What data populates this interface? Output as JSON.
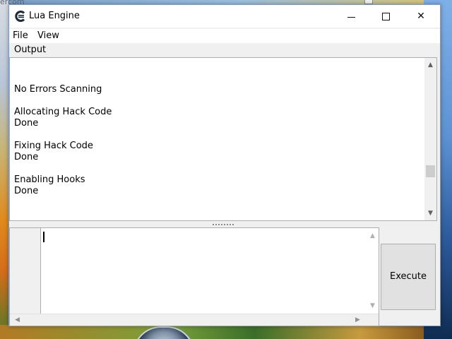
{
  "background": {
    "corner_text": "ercom"
  },
  "window": {
    "title": "Lua Engine",
    "controls": {
      "minimize": "minimize-icon",
      "maximize": "maximize-icon",
      "close": "✕"
    }
  },
  "menu": {
    "file": "File",
    "view": "View"
  },
  "output": {
    "label": "Output",
    "lines": [
      "No Errors Scanning",
      "Allocating Hack Code",
      "Done",
      "Fixing Hack Code",
      "Done",
      "Enabling Hooks",
      "Done"
    ],
    "scroll_up": "▲",
    "scroll_down": "▼"
  },
  "editor": {
    "content": "",
    "scroll_up": "▲",
    "scroll_down": "▼",
    "scroll_left": "◀",
    "scroll_right": "▶"
  },
  "execute_button": {
    "label": "Execute"
  },
  "colors": {
    "accent": "#7a9cc6",
    "window_bg": "#f0f0f0",
    "panel_border": "#adadad"
  }
}
